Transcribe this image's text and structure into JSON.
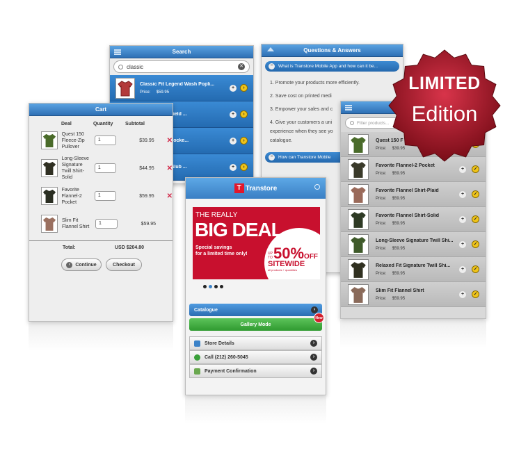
{
  "search": {
    "title": "Search",
    "query": "classic",
    "price_label": "Price:",
    "items": [
      {
        "title": "Classic Fit Legend Wash Popli...",
        "price": "$59.95"
      },
      {
        "title": "Long-Sleeve Field ...",
        "price": ""
      },
      {
        "title": "Long-Sleeve Pocke...",
        "price": ""
      },
      {
        "title": "Short-Sleeve Slub ...",
        "price": ""
      }
    ]
  },
  "qa": {
    "title": "Questions & Answers",
    "q1": "What is Transtore Mobile App and how can it be...",
    "answers": [
      "1. Promote your products more efficiently.",
      "2. Save cost on printed medi",
      "3. Empower your sales and c",
      "4. Give your customers a uni",
      "experience when they see yo",
      "catalogue."
    ],
    "q2": "How can Transtore Mobile"
  },
  "cart": {
    "title": "Cart",
    "col_deal": "Deal",
    "col_quantity": "Quantity",
    "col_subtotal": "Subtotal",
    "items": [
      {
        "name": "Quest 150 Fleece-Zip Pullover",
        "qty": "1",
        "subtotal": "$39.95"
      },
      {
        "name": "Long-Sleeve Signature Twill Shirt-Solid",
        "qty": "1",
        "subtotal": "$44.95"
      },
      {
        "name": "Favorite Flannel-2 Pocket",
        "qty": "1",
        "subtotal": "$59.95"
      },
      {
        "name": "Slim Fit Flannel Shirt",
        "qty": "1",
        "subtotal": "$59.95"
      }
    ],
    "total_label": "Total:",
    "total_value": "USD $204.80",
    "continue_label": "Continue",
    "checkout_label": "Checkout",
    "remove_glyph": "✕"
  },
  "home": {
    "brand": "Transtore",
    "banner": {
      "line1": "THE REALLY",
      "big": "BIG DEAL",
      "event": "EVENT",
      "promo1": "Special savings",
      "promo2": "for a limited time only!",
      "upto": "UP TO",
      "percent": "50%",
      "off": "OFF",
      "sitewide": "SITEWIDE",
      "fine": "all products + quantities"
    },
    "catalogue_label": "Catalogue",
    "gallery_label": "Gallery Mode",
    "new_badge": "New",
    "store_details": "Store Details",
    "call": "Call (212) 260-5045",
    "payment": "Payment Confirmation"
  },
  "catalog": {
    "filter_placeholder": "Filter products...",
    "price_label": "Price:",
    "items": [
      {
        "title": "Quest 150 F",
        "price": "$39.95",
        "color": "#4a6b2a"
      },
      {
        "title": "Favorite Flannel-2 Pocket",
        "price": "$59.95",
        "color": "#3a3a2a"
      },
      {
        "title": "Favorite Flannel Shirt-Plaid",
        "price": "$59.95",
        "color": "#9a6a5a"
      },
      {
        "title": "Favorite Flannel Shirt-Solid",
        "price": "$59.95",
        "color": "#2e3a24"
      },
      {
        "title": "Long-Sleeve Signature Twill Shi...",
        "price": "$59.95",
        "color": "#3f5a2a"
      },
      {
        "title": "Relaxed Fit Signature Twill Shi...",
        "price": "$59.95",
        "color": "#303020"
      },
      {
        "title": "Slim Fit Flannel Shirt",
        "price": "$59.95",
        "color": "#8a6a5a"
      }
    ]
  },
  "badge": {
    "line1": "LIMITED",
    "line2": "Edition"
  }
}
